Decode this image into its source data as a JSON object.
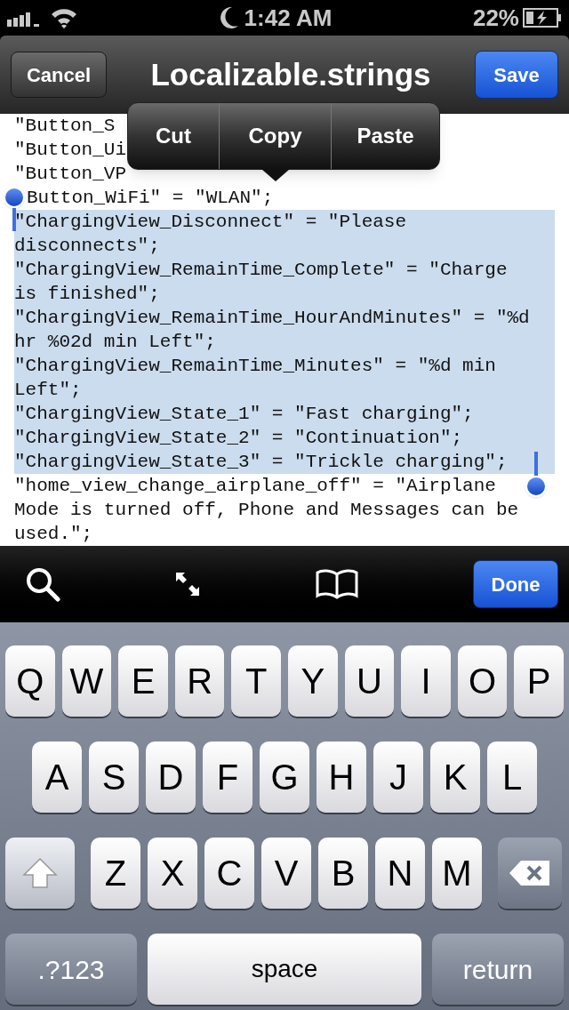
{
  "status_bar": {
    "time": "1:42 AM",
    "battery": "22%"
  },
  "nav_bar": {
    "cancel": "Cancel",
    "title": "Localizable.strings",
    "save": "Save"
  },
  "edit_menu": [
    "Cut",
    "Copy",
    "Paste"
  ],
  "lines": [
    {
      "text": "\"Button_S",
      "selected": false
    },
    {
      "text": "\"Button_Ui",
      "selected": false
    },
    {
      "text": "\"Button_VP",
      "selected": false
    },
    {
      "text": "Button_WiFi\" = \"WLAN\";",
      "selected": false
    },
    {
      "text": "\"ChargingView_Disconnect\" = \"Please",
      "selected": true
    },
    {
      "text": "disconnects\";",
      "selected": true
    },
    {
      "text": "\"ChargingView_RemainTime_Complete\" = \"Charge",
      "selected": true
    },
    {
      "text": "is finished\";",
      "selected": true
    },
    {
      "text": "\"ChargingView_RemainTime_HourAndMinutes\" = \"%d",
      "selected": true
    },
    {
      "text": "hr %02d min Left\";",
      "selected": true
    },
    {
      "text": "\"ChargingView_RemainTime_Minutes\" = \"%d min",
      "selected": true
    },
    {
      "text": "Left\";",
      "selected": true
    },
    {
      "text": "\"ChargingView_State_1\" = \"Fast charging\";",
      "selected": true
    },
    {
      "text": "\"ChargingView_State_2\" = \"Continuation\";",
      "selected": true
    },
    {
      "text": "\"ChargingView_State_3\" = \"Trickle charging\";",
      "selected": true
    },
    {
      "text": "\"home_view_change_airplane_off\" = \"Airplane",
      "selected": false
    },
    {
      "text": "Mode is turned off, Phone and Messages can be",
      "selected": false
    },
    {
      "text": "used.\";",
      "selected": false
    }
  ],
  "toolbar": {
    "done": "Done"
  },
  "keyboard": [
    [
      {
        "kind": "letter",
        "label": "Q"
      },
      {
        "kind": "letter",
        "label": "W"
      },
      {
        "kind": "letter",
        "label": "E"
      },
      {
        "kind": "letter",
        "label": "R"
      },
      {
        "kind": "letter",
        "label": "T"
      },
      {
        "kind": "letter",
        "label": "Y"
      },
      {
        "kind": "letter",
        "label": "U"
      },
      {
        "kind": "letter",
        "label": "I"
      },
      {
        "kind": "letter",
        "label": "O"
      },
      {
        "kind": "letter",
        "label": "P"
      }
    ],
    [
      {
        "kind": "letter",
        "label": "A"
      },
      {
        "kind": "letter",
        "label": "S"
      },
      {
        "kind": "letter",
        "label": "D"
      },
      {
        "kind": "letter",
        "label": "F"
      },
      {
        "kind": "letter",
        "label": "G"
      },
      {
        "kind": "letter",
        "label": "H"
      },
      {
        "kind": "letter",
        "label": "J"
      },
      {
        "kind": "letter",
        "label": "K"
      },
      {
        "kind": "letter",
        "label": "L"
      }
    ],
    [
      {
        "kind": "shift"
      },
      {
        "kind": "letter",
        "label": "Z"
      },
      {
        "kind": "letter",
        "label": "X"
      },
      {
        "kind": "letter",
        "label": "C"
      },
      {
        "kind": "letter",
        "label": "V"
      },
      {
        "kind": "letter",
        "label": "B"
      },
      {
        "kind": "letter",
        "label": "N"
      },
      {
        "kind": "letter",
        "label": "M"
      },
      {
        "kind": "delete"
      }
    ],
    [
      {
        "kind": "mode",
        "label": ".?123"
      },
      {
        "kind": "space",
        "label": "space"
      },
      {
        "kind": "return",
        "label": "return"
      }
    ]
  ]
}
